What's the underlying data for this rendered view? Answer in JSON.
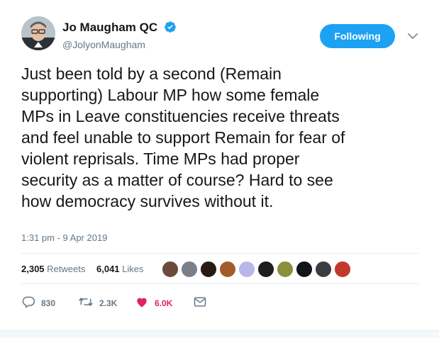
{
  "author": {
    "name": "Jo Maugham QC",
    "handle": "@JolyonMaugham"
  },
  "follow_button": {
    "label": "Following"
  },
  "tweet": {
    "lines": [
      "Just been told by a second (Remain",
      "supporting) Labour MP how some female",
      "MPs in Leave constituencies receive threats",
      "and feel unable to support Remain for fear of",
      "violent reprisals. Time MPs had proper",
      "security as a matter of course? Hard to see",
      "how democracy survives without it."
    ],
    "timestamp": "1:31 pm - 9 Apr 2019"
  },
  "stats": {
    "retweets_count": "2,305",
    "retweets_label": "Retweets",
    "likes_count": "6,041",
    "likes_label": "Likes"
  },
  "actions": {
    "reply_count": "830",
    "retweet_count": "2.3K",
    "like_count": "6.0K"
  },
  "colors": {
    "accent": "#1da1f2",
    "like": "#e0245e",
    "secondary_text": "#657786"
  },
  "icons": [
    "verified-badge-icon",
    "chevron-down-icon",
    "reply-icon",
    "retweet-icon",
    "heart-icon",
    "message-icon"
  ]
}
